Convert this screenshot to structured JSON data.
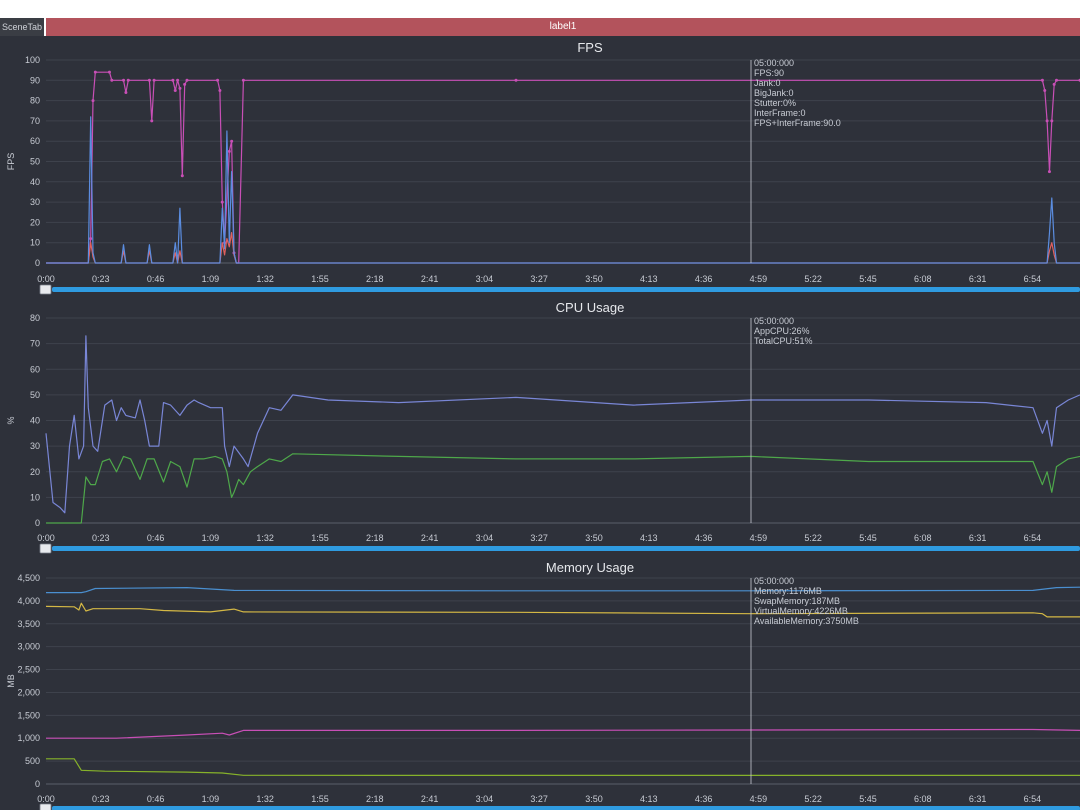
{
  "header": {
    "scene_tab": "SceneTab",
    "label": "label1"
  },
  "colors": {
    "background": "#2e313a",
    "grid": "#3e424c",
    "axis_text": "#c8ccd4",
    "cursor": "#c8ccd4",
    "slider": "#2f9be0",
    "fps": "#c84fb6",
    "jank": "#e0605f",
    "bigjank": "#5b8de0",
    "app_cpu": "#4ea84a",
    "total_cpu": "#7986d6",
    "memory": "#c84fb6",
    "swap_memory": "#86b22a",
    "virtual_memory": "#4a8fd0",
    "available_memory": "#d4b845"
  },
  "x_ticks": [
    "0:00",
    "0:23",
    "0:46",
    "1:09",
    "1:32",
    "1:55",
    "2:18",
    "2:41",
    "3:04",
    "3:27",
    "3:50",
    "4:13",
    "4:36",
    "4:59",
    "5:22",
    "5:45",
    "6:08",
    "6:31",
    "6:54"
  ],
  "chart_data": [
    {
      "type": "line",
      "title": "FPS",
      "ylabel": "FPS",
      "ylim": [
        0,
        100
      ],
      "yticks": [
        "0",
        "10",
        "20",
        "30",
        "40",
        "50",
        "60",
        "70",
        "80",
        "90",
        "100"
      ],
      "grid": true,
      "cursor_x": "5:00",
      "tooltip": [
        "05:00:000",
        "FPS:90",
        "Jank:0",
        "BigJank:0",
        "Stutter:0%",
        "InterFrame:0",
        "FPS+InterFrame:90.0"
      ],
      "series": [
        {
          "color_key": "fps",
          "points": [
            [
              0,
              0
            ],
            [
              18,
              0
            ],
            [
              19,
              12
            ],
            [
              20,
              80
            ],
            [
              21,
              94
            ],
            [
              27,
              94
            ],
            [
              28,
              90
            ],
            [
              33,
              90
            ],
            [
              34,
              84
            ],
            [
              35,
              90
            ],
            [
              44,
              90
            ],
            [
              45,
              70
            ],
            [
              46,
              90
            ],
            [
              54,
              90
            ],
            [
              55,
              85
            ],
            [
              56,
              90
            ],
            [
              57,
              86
            ],
            [
              58,
              43
            ],
            [
              59,
              88
            ],
            [
              60,
              90
            ],
            [
              73,
              90
            ],
            [
              74,
              85
            ],
            [
              75,
              30
            ],
            [
              76,
              10
            ],
            [
              78,
              55
            ],
            [
              79,
              60
            ],
            [
              80,
              5
            ],
            [
              81,
              0
            ],
            [
              82,
              0
            ],
            [
              84,
              90
            ],
            [
              200,
              90
            ],
            [
              424,
              90
            ],
            [
              425,
              85
            ],
            [
              426,
              70
            ],
            [
              427,
              45
            ],
            [
              428,
              70
            ],
            [
              429,
              88
            ],
            [
              430,
              90
            ],
            [
              440,
              90
            ]
          ]
        },
        {
          "color_key": "jank",
          "points": [
            [
              0,
              0
            ],
            [
              18,
              0
            ],
            [
              19,
              10
            ],
            [
              20,
              3
            ],
            [
              21,
              0
            ],
            [
              32,
              0
            ],
            [
              33,
              6
            ],
            [
              34,
              0
            ],
            [
              43,
              0
            ],
            [
              44,
              6
            ],
            [
              45,
              0
            ],
            [
              54,
              0
            ],
            [
              55,
              5
            ],
            [
              56,
              0
            ],
            [
              57,
              6
            ],
            [
              58,
              0
            ],
            [
              74,
              0
            ],
            [
              75,
              10
            ],
            [
              76,
              4
            ],
            [
              77,
              12
            ],
            [
              78,
              8
            ],
            [
              79,
              15
            ],
            [
              80,
              4
            ],
            [
              81,
              0
            ],
            [
              426,
              0
            ],
            [
              427,
              6
            ],
            [
              428,
              10
            ],
            [
              429,
              4
            ],
            [
              430,
              0
            ],
            [
              440,
              0
            ]
          ]
        },
        {
          "color_key": "bigjank",
          "points": [
            [
              0,
              0
            ],
            [
              18,
              0
            ],
            [
              19,
              72
            ],
            [
              20,
              5
            ],
            [
              21,
              0
            ],
            [
              32,
              0
            ],
            [
              33,
              9
            ],
            [
              34,
              0
            ],
            [
              43,
              0
            ],
            [
              44,
              9
            ],
            [
              45,
              0
            ],
            [
              54,
              0
            ],
            [
              55,
              10
            ],
            [
              56,
              0
            ],
            [
              57,
              27
            ],
            [
              58,
              0
            ],
            [
              74,
              0
            ],
            [
              75,
              27
            ],
            [
              76,
              7
            ],
            [
              77,
              65
            ],
            [
              78,
              10
            ],
            [
              79,
              45
            ],
            [
              80,
              5
            ],
            [
              81,
              0
            ],
            [
              426,
              0
            ],
            [
              427,
              15
            ],
            [
              428,
              32
            ],
            [
              429,
              10
            ],
            [
              430,
              0
            ],
            [
              440,
              0
            ]
          ]
        }
      ]
    },
    {
      "type": "line",
      "title": "CPU Usage",
      "ylabel": "%",
      "ylim": [
        0,
        80
      ],
      "yticks": [
        "0",
        "10",
        "20",
        "30",
        "40",
        "50",
        "60",
        "70",
        "80"
      ],
      "grid": true,
      "cursor_x": "5:00",
      "tooltip": [
        "05:00:000",
        "AppCPU:26%",
        "TotalCPU:51%"
      ],
      "series": [
        {
          "color_key": "total_cpu",
          "points": [
            [
              0,
              35
            ],
            [
              3,
              8
            ],
            [
              6,
              6
            ],
            [
              8,
              4
            ],
            [
              10,
              30
            ],
            [
              12,
              42
            ],
            [
              14,
              25
            ],
            [
              16,
              30
            ],
            [
              17,
              73
            ],
            [
              18,
              45
            ],
            [
              20,
              30
            ],
            [
              22,
              28
            ],
            [
              25,
              46
            ],
            [
              28,
              48
            ],
            [
              30,
              40
            ],
            [
              32,
              45
            ],
            [
              34,
              42
            ],
            [
              38,
              41
            ],
            [
              40,
              48
            ],
            [
              42,
              40
            ],
            [
              44,
              30
            ],
            [
              48,
              30
            ],
            [
              50,
              47
            ],
            [
              53,
              46
            ],
            [
              57,
              42
            ],
            [
              60,
              46
            ],
            [
              63,
              48
            ],
            [
              65,
              47
            ],
            [
              70,
              45
            ],
            [
              75,
              45
            ],
            [
              76,
              30
            ],
            [
              78,
              22
            ],
            [
              80,
              30
            ],
            [
              84,
              25
            ],
            [
              86,
              22
            ],
            [
              90,
              35
            ],
            [
              95,
              45
            ],
            [
              100,
              44
            ],
            [
              105,
              50
            ],
            [
              120,
              48
            ],
            [
              150,
              47
            ],
            [
              200,
              49
            ],
            [
              250,
              46
            ],
            [
              300,
              48
            ],
            [
              350,
              48
            ],
            [
              400,
              47
            ],
            [
              420,
              45
            ],
            [
              424,
              35
            ],
            [
              426,
              40
            ],
            [
              428,
              30
            ],
            [
              430,
              45
            ],
            [
              435,
              48
            ],
            [
              440,
              50
            ]
          ]
        },
        {
          "color_key": "app_cpu",
          "points": [
            [
              0,
              0
            ],
            [
              15,
              0
            ],
            [
              17,
              18
            ],
            [
              19,
              15
            ],
            [
              21,
              15
            ],
            [
              24,
              24
            ],
            [
              27,
              25
            ],
            [
              30,
              20
            ],
            [
              33,
              26
            ],
            [
              36,
              25
            ],
            [
              40,
              17
            ],
            [
              43,
              25
            ],
            [
              46,
              25
            ],
            [
              50,
              16
            ],
            [
              53,
              24
            ],
            [
              57,
              22
            ],
            [
              60,
              14
            ],
            [
              63,
              25
            ],
            [
              67,
              25
            ],
            [
              72,
              26
            ],
            [
              75,
              25
            ],
            [
              77,
              20
            ],
            [
              79,
              10
            ],
            [
              80,
              12
            ],
            [
              82,
              17
            ],
            [
              84,
              15
            ],
            [
              87,
              20
            ],
            [
              90,
              22
            ],
            [
              95,
              25
            ],
            [
              100,
              24
            ],
            [
              105,
              27
            ],
            [
              150,
              26
            ],
            [
              200,
              25
            ],
            [
              250,
              25
            ],
            [
              300,
              26
            ],
            [
              350,
              24
            ],
            [
              400,
              24
            ],
            [
              420,
              24
            ],
            [
              424,
              15
            ],
            [
              426,
              20
            ],
            [
              428,
              12
            ],
            [
              430,
              22
            ],
            [
              435,
              25
            ],
            [
              440,
              26
            ]
          ]
        }
      ]
    },
    {
      "type": "line",
      "title": "Memory Usage",
      "ylabel": "MB",
      "ylim": [
        0,
        4500
      ],
      "yticks": [
        "0",
        "500",
        "1,000",
        "1,500",
        "2,000",
        "2,500",
        "3,000",
        "3,500",
        "4,000",
        "4,500"
      ],
      "grid": true,
      "cursor_x": "5:00",
      "tooltip": [
        "05:00:000",
        "Memory:1176MB",
        "SwapMemory:187MB",
        "VirtualMemory:4226MB",
        "AvailableMemory:3750MB"
      ],
      "series": [
        {
          "color_key": "virtual_memory",
          "points": [
            [
              0,
              4180
            ],
            [
              15,
              4180
            ],
            [
              17,
              4200
            ],
            [
              21,
              4270
            ],
            [
              60,
              4290
            ],
            [
              80,
              4230
            ],
            [
              200,
              4220
            ],
            [
              300,
              4220
            ],
            [
              420,
              4230
            ],
            [
              430,
              4290
            ],
            [
              440,
              4300
            ]
          ]
        },
        {
          "color_key": "available_memory",
          "points": [
            [
              0,
              3880
            ],
            [
              12,
              3870
            ],
            [
              14,
              3800
            ],
            [
              15,
              3950
            ],
            [
              17,
              3780
            ],
            [
              20,
              3830
            ],
            [
              40,
              3830
            ],
            [
              50,
              3790
            ],
            [
              70,
              3760
            ],
            [
              80,
              3820
            ],
            [
              84,
              3760
            ],
            [
              200,
              3750
            ],
            [
              300,
              3720
            ],
            [
              420,
              3740
            ],
            [
              424,
              3720
            ],
            [
              426,
              3650
            ],
            [
              440,
              3650
            ]
          ]
        },
        {
          "color_key": "memory",
          "points": [
            [
              0,
              1000
            ],
            [
              30,
              1000
            ],
            [
              60,
              1070
            ],
            [
              75,
              1110
            ],
            [
              78,
              1070
            ],
            [
              84,
              1170
            ],
            [
              200,
              1170
            ],
            [
              300,
              1180
            ],
            [
              420,
              1190
            ],
            [
              440,
              1170
            ]
          ]
        },
        {
          "color_key": "swap_memory",
          "points": [
            [
              0,
              550
            ],
            [
              12,
              550
            ],
            [
              15,
              300
            ],
            [
              25,
              280
            ],
            [
              60,
              260
            ],
            [
              75,
              240
            ],
            [
              84,
              190
            ],
            [
              200,
              187
            ],
            [
              300,
              187
            ],
            [
              440,
              187
            ]
          ]
        }
      ]
    }
  ]
}
